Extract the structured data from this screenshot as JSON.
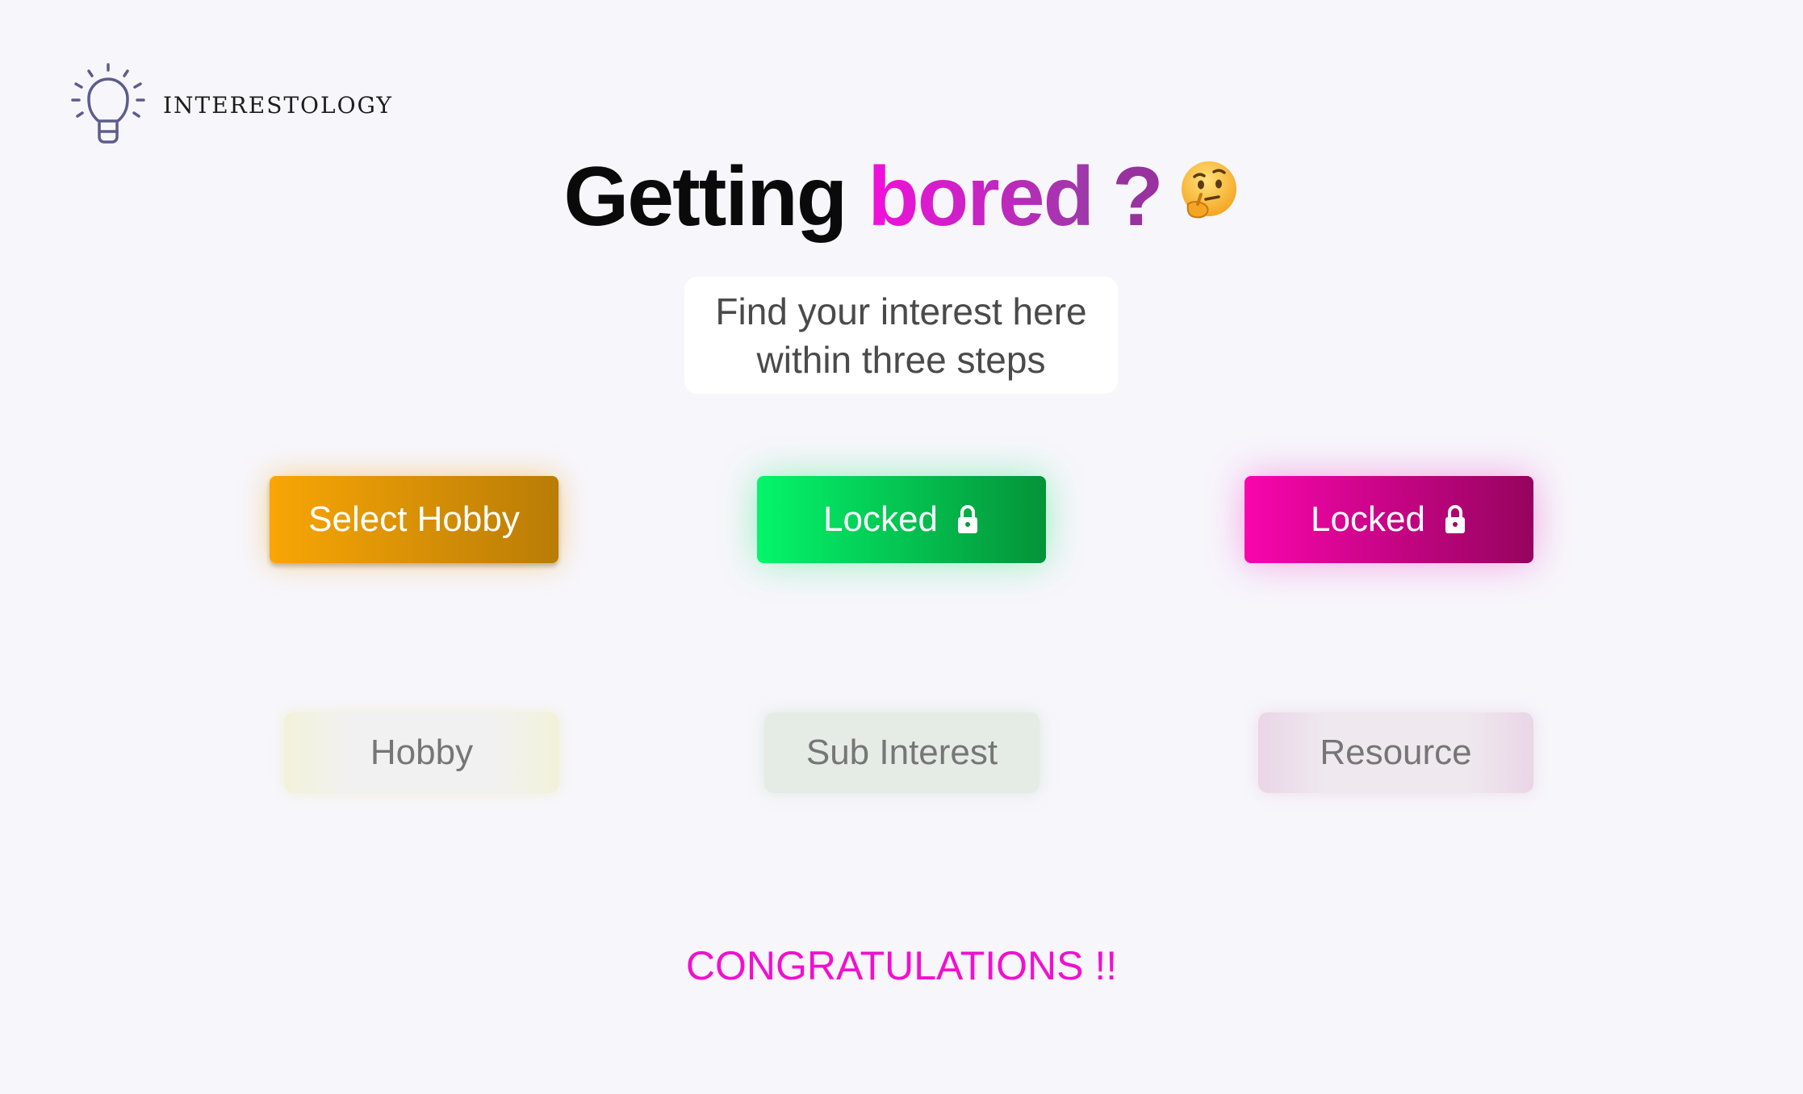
{
  "brand": {
    "name": "INTERESTOLOGY",
    "icon": "lightbulb-icon",
    "icon_color": "#5d5c8e"
  },
  "hero": {
    "word_1": "Getting",
    "word_2": "bored",
    "punctuation": "?",
    "emoji": "thinking-face-icon",
    "accent_gradient": [
      "#f20fdc",
      "#9b3aa8"
    ]
  },
  "subtitle": {
    "text": "Find your interest here within three steps"
  },
  "steps": [
    {
      "label": "Select Hobby",
      "locked": false,
      "gradient": [
        "#f8a605",
        "#b97c06"
      ]
    },
    {
      "label": "Locked",
      "locked": true,
      "icon": "lock-icon",
      "gradient": [
        "#04f56b",
        "#049338"
      ]
    },
    {
      "label": "Locked",
      "locked": true,
      "icon": "lock-icon",
      "gradient": [
        "#f905ad",
        "#96045e"
      ]
    }
  ],
  "tags": [
    {
      "label": "Hobby"
    },
    {
      "label": "Sub Interest"
    },
    {
      "label": "Resource"
    }
  ],
  "footer": {
    "message": "CONGRATULATIONS !!",
    "color": "#f20fcf"
  }
}
